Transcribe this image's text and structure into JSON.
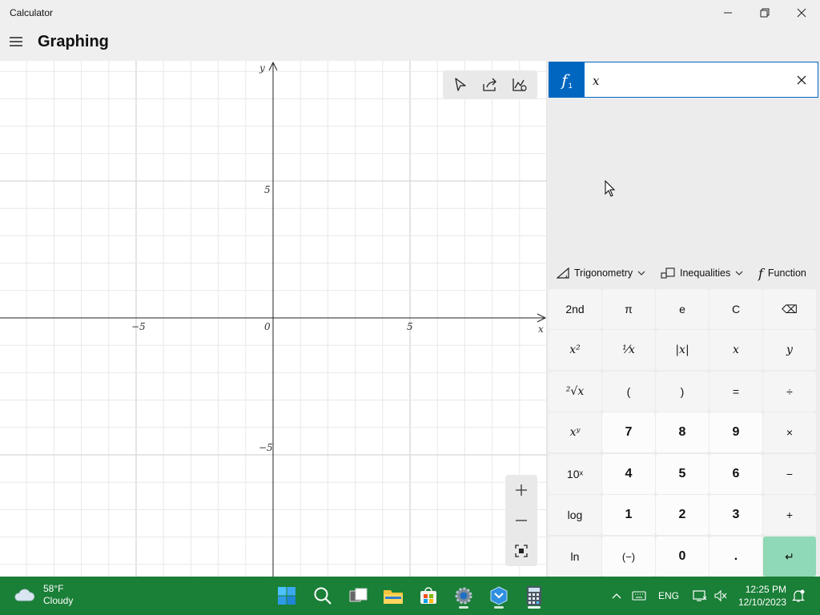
{
  "window": {
    "title": "Calculator"
  },
  "header": {
    "mode": "Graphing"
  },
  "graph": {
    "axis_labels": {
      "x": "x",
      "y": "y"
    },
    "ticks": {
      "x_neg": "−5",
      "x_pos": "5",
      "origin": "0",
      "y_pos": "5",
      "y_neg": "−5"
    }
  },
  "functions": [
    {
      "label": "f",
      "subscript": "1",
      "value": "x"
    }
  ],
  "func_toolbar": {
    "trig": "Trigonometry",
    "ineq": "Inequalities",
    "func": "Function"
  },
  "keypad": {
    "rows": [
      [
        "2nd",
        "π",
        "e",
        "C",
        "⌫"
      ],
      [
        "x²",
        "¹⁄x",
        "|x|",
        "x",
        "y"
      ],
      [
        "²√x",
        "(",
        ")",
        "=",
        "÷"
      ],
      [
        "xʸ",
        "7",
        "8",
        "9",
        "×"
      ],
      [
        "10ˣ",
        "4",
        "5",
        "6",
        "−"
      ],
      [
        "log",
        "1",
        "2",
        "3",
        "+"
      ],
      [
        "ln",
        "(−)",
        "0",
        ".",
        "↵"
      ]
    ]
  },
  "taskbar": {
    "weather_temp": "58°F",
    "weather_desc": "Cloudy",
    "lang": "ENG",
    "time": "12:25 PM",
    "date": "12/10/2023"
  },
  "colors": {
    "accent": "#0067c0",
    "enter": "#8fd9b6",
    "taskbar": "#1a7f37"
  }
}
